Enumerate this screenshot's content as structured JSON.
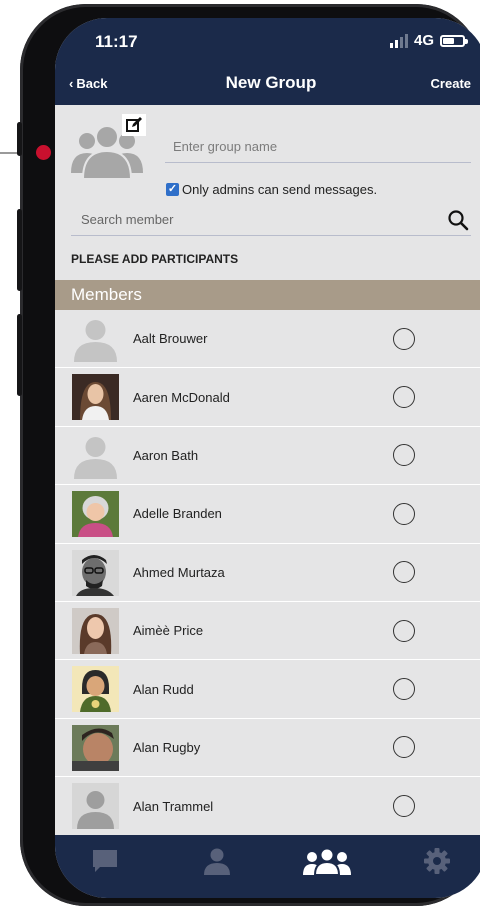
{
  "status_bar": {
    "time": "11:17",
    "network": "4G"
  },
  "nav": {
    "back_label": "Back",
    "title": "New Group",
    "create_label": "Create"
  },
  "group": {
    "name_placeholder": "Enter group name",
    "admin_only_label": "Only admins can send messages.",
    "admin_only_checked": true
  },
  "search": {
    "placeholder": "Search member"
  },
  "participants_heading": "PLEASE ADD PARTICIPANTS",
  "members_heading": "Members",
  "members": [
    {
      "name": "Aalt Brouwer",
      "photo": "placeholder-avatar"
    },
    {
      "name": "Aaren McDonald",
      "photo": "photo"
    },
    {
      "name": "Aaron Bath",
      "photo": "placeholder-avatar"
    },
    {
      "name": "Adelle Branden",
      "photo": "photo"
    },
    {
      "name": "Ahmed Murtaza",
      "photo": "photo"
    },
    {
      "name": "Aimèè Price",
      "photo": "photo"
    },
    {
      "name": "Alan Rudd",
      "photo": "illustrated-avatar"
    },
    {
      "name": "Alan Rugby",
      "photo": "photo"
    },
    {
      "name": "Alan Trammel",
      "photo": "placeholder-avatar"
    }
  ],
  "tabs": [
    {
      "icon": "chat-icon",
      "active": false
    },
    {
      "icon": "contact-icon",
      "active": false
    },
    {
      "icon": "groups-icon",
      "active": true
    },
    {
      "icon": "settings-icon",
      "active": false
    }
  ],
  "colors": {
    "header": "#1b2a4a",
    "members_header": "#a89b89",
    "screen_background": "#e5e5e6",
    "annotation_dot": "#c8102e",
    "checkbox": "#2f6fc9"
  }
}
